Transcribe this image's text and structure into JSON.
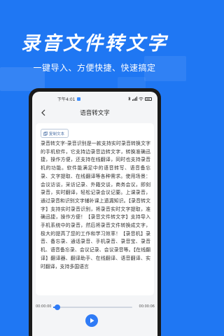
{
  "promo": {
    "title": "录音文件转文字",
    "subtitle": "一键导入、方便快捷、快速搞定"
  },
  "status_bar": {
    "time": "下午4:01"
  },
  "header": {
    "title": "语音转文字",
    "back_icon": "chevron-left-icon"
  },
  "card": {
    "copy_label": "复制文本",
    "copy_icon": "copy-icon",
    "transcript": "录音转文字-录音识别是一款支持实时录音转换文字的手机软件，它支持边录音边转文字，转换准确迅捷，操作方便，还支持在线翻译，同时也支持录音机的功能。软件能满足中的语音转写、语音备忘录、文字提取、在线翻译等各种需求。使用场景：会议访谈，采访记录、外籍交谈，商务会议，即刻录音，实时翻译，轻松记录会议记要。上课录音，通过录音和识别文字辅补课上遗漏知识。【录音转文字】支持实时录音识别，将录音实时文字提取，准确迅捷，操作方便！【录音文件转文字】支持导入手机系统中的录音，然后将录音文件转换成文字，极大的提高了您的工作和学习效率！【录音机】录音、备忘录、通话录音、手机录音、录音宝、录音机、语音备忘录、会议记录、会议录音等。【在线翻译】翻译器、翻译助手、在线翻译、语音翻译、实时翻译，支持多国语言"
  },
  "player": {
    "current_time": "00:00:00",
    "total_time": "00:00:06",
    "progress": 0.05,
    "play_icon": "play-icon"
  },
  "colors": {
    "background": "#1F77F3",
    "accent": "#2F7BF6"
  }
}
